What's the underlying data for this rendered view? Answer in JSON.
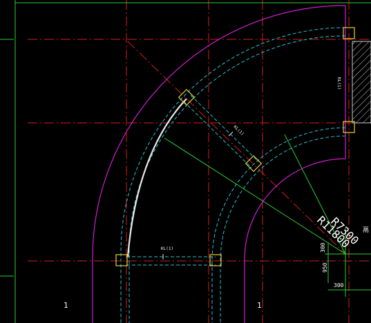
{
  "colors": {
    "background": "#000000",
    "axis_red": "#d61f1f",
    "wall_magenta": "#d11fd1",
    "wall_cyan": "#22c7d6",
    "wall_white": "#e8e8e8",
    "beam_gray": "#bdbdbd",
    "dimension_green": "#2fd12f",
    "column_yellow": "#e6d23a",
    "text_white": "#ffffff",
    "hatch": "#cfcfcf"
  },
  "labels": {
    "radius_outer": "R7300",
    "radius_inner": "R11800",
    "beam_tag_1": "KL(1)",
    "beam_tag_2": "KL(1)",
    "beam_tag_3": "KL(1)",
    "dim_300_a": "300",
    "dim_950": "950",
    "dim_300_b": "300",
    "axis_bubble_left": "1",
    "axis_bubble_right": "1",
    "edge_mark": "鬲"
  }
}
